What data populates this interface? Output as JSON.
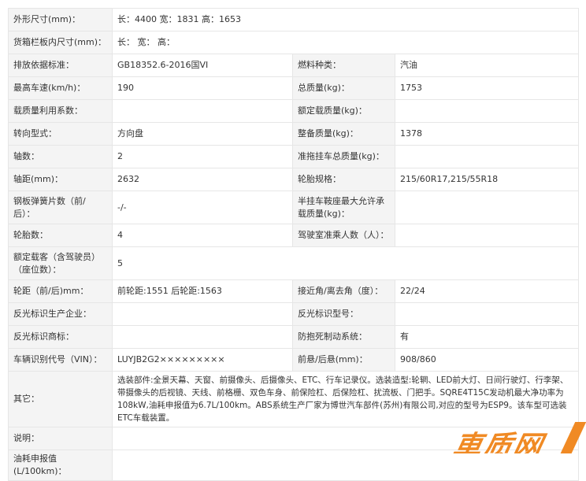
{
  "rows": [
    {
      "label": "外形尺寸(mm)：",
      "value": "长：4400 宽：1831 高：1653"
    },
    {
      "label": "货箱栏板内尺寸(mm)：",
      "value": "长：  宽：  高："
    },
    {
      "label": "排放依据标准：",
      "value": "GB18352.6-2016国VI",
      "label2": "燃料种类：",
      "value2": "汽油"
    },
    {
      "label": "最高车速(km/h)：",
      "value": "190",
      "label2": "总质量(kg)：",
      "value2": "1753"
    },
    {
      "label": "载质量利用系数：",
      "value": "",
      "label2": "额定载质量(kg)：",
      "value2": ""
    },
    {
      "label": "转向型式：",
      "value": "方向盘",
      "label2": "整备质量(kg)：",
      "value2": "1378"
    },
    {
      "label": "轴数：",
      "value": "2",
      "label2": "准拖挂车总质量(kg)：",
      "value2": ""
    },
    {
      "label": "轴距(mm)：",
      "value": "2632",
      "label2": "轮胎规格：",
      "value2": "215/60R17,215/55R18"
    },
    {
      "label": "钢板弹簧片数（前/后）：",
      "value": "-/-",
      "label2": "半挂车鞍座最大允许承载质量(kg)：",
      "value2": ""
    },
    {
      "label": "轮胎数：",
      "value": "4",
      "label2": "驾驶室准乘人数（人）：",
      "value2": ""
    },
    {
      "label": "额定载客（含驾驶员）（座位数）：",
      "value": "5"
    },
    {
      "label": "轮距（前/后)mm：",
      "value": "前轮距:1551 后轮距:1563",
      "label2": "接近角/离去角（度）：",
      "value2": "22/24"
    },
    {
      "label": "反光标识生产企业：",
      "value": "",
      "label2": "反光标识型号：",
      "value2": ""
    },
    {
      "label": "反光标识商标：",
      "value": "",
      "label2": "防抱死制动系统：",
      "value2": "有"
    },
    {
      "label": "车辆识别代号（VIN）：",
      "value": "LUYJB2G2×××××××××",
      "label2": "前悬/后悬(mm)：",
      "value2": "908/860"
    },
    {
      "label": "其它：",
      "value": "选装部件:全景天幕、天窗、前摄像头、后摄像头、ETC、行车记录仪。选装造型:轮辋、LED前大灯、日间行驶灯、行李架、带摄像头的后视镜、天线、前格栅、双色车身、前保险杠、后保险杠、扰流板、门把手。SQRE4T15C发动机最大净功率为108kW,油耗申报值为6.7L/100km。ABS系统生产厂家为博世汽车部件(苏州)有限公司,对应的型号为ESP9。该车型可选装ETC车载装置。"
    },
    {
      "label": "说明：",
      "value": ""
    },
    {
      "label": "油耗申报值(L/100km)：",
      "value": ""
    }
  ],
  "watermark": "車质网"
}
